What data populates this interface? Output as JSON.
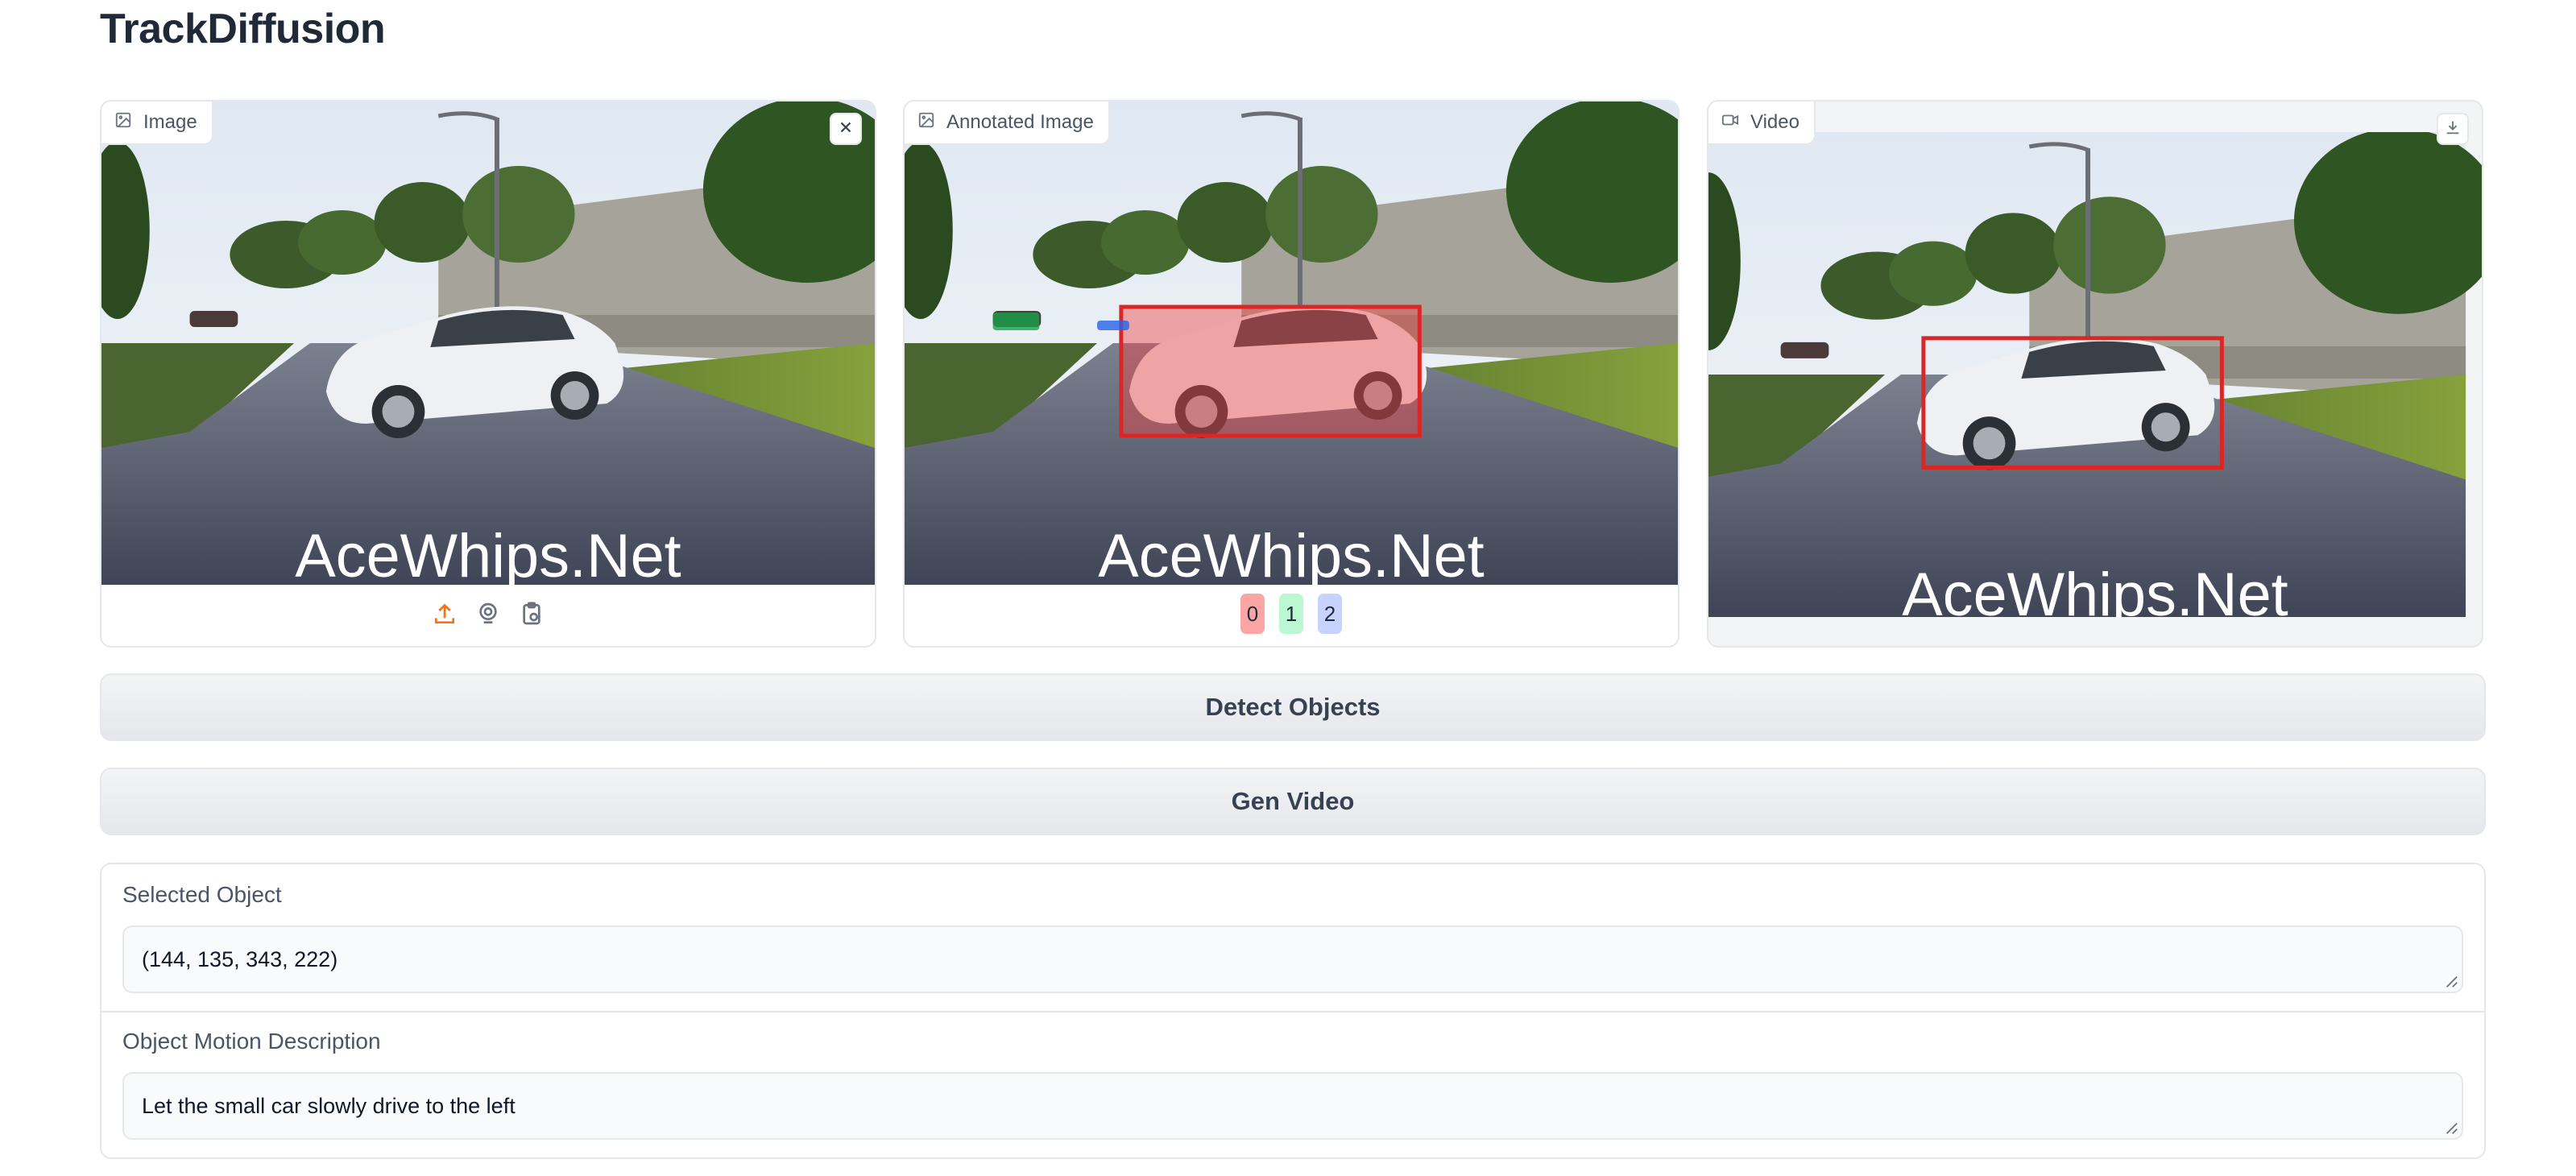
{
  "app": {
    "title": "TrackDiffusion"
  },
  "panels": {
    "image": {
      "label": "Image",
      "icon": "image-icon",
      "close_icon": "close-icon",
      "watermark": "AceWhips.Net",
      "toolbar_icons": [
        "upload-icon",
        "webcam-icon",
        "clipboard-icon"
      ]
    },
    "annotated": {
      "label": "Annotated Image",
      "icon": "image-icon",
      "watermark": "AceWhips.Net",
      "legend": [
        {
          "label": "0",
          "color": "#fca5a5"
        },
        {
          "label": "1",
          "color": "#bbf7d0"
        },
        {
          "label": "2",
          "color": "#c7d2fe"
        }
      ]
    },
    "video": {
      "label": "Video",
      "icon": "video-icon",
      "download_icon": "download-icon",
      "watermark": "AceWhips.Net"
    }
  },
  "buttons": {
    "detect": "Detect Objects",
    "gen_video": "Gen Video"
  },
  "form": {
    "selected_object": {
      "label": "Selected Object",
      "value": "(144, 135, 343, 222)"
    },
    "motion_description": {
      "label": "Object Motion Description",
      "value": "Let the small car slowly drive to the left"
    }
  },
  "colors": {
    "accent": "#f97316",
    "mask_red": "#ef4444",
    "mask_green": "#16a34a",
    "mask_blue": "#2563eb"
  }
}
